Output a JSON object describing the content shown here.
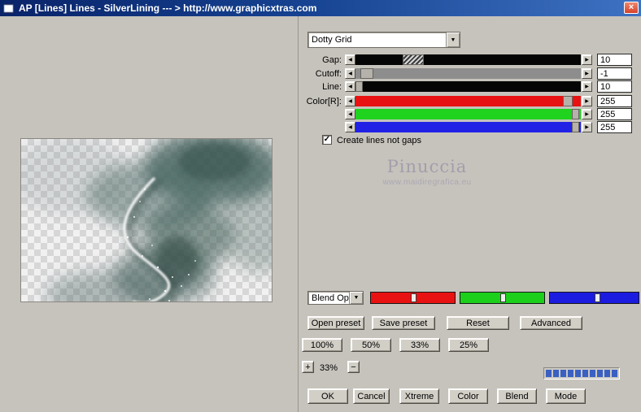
{
  "titlebar": {
    "title": "AP [Lines]  Lines - SilverLining    --- > http://www.graphicxtras.com",
    "close_glyph": "×"
  },
  "preset_dropdown": {
    "value": "Dotty Grid",
    "arrow_glyph": "▼"
  },
  "arrows": {
    "left": "◀",
    "right": "▶"
  },
  "sliders": [
    {
      "label": "Gap:",
      "value": "10",
      "track_color": "#050505",
      "thumb_pct": 21,
      "thumb_w": 26,
      "thumb_kind": "hatched"
    },
    {
      "label": "Cutoff:",
      "value": "-1",
      "track_color": "#8d8d8d",
      "thumb_pct": 2,
      "thumb_w": 16,
      "thumb_kind": "plain"
    },
    {
      "label": "Line:",
      "value": "10",
      "track_color": "#050505",
      "thumb_pct": 0,
      "thumb_w": 9,
      "thumb_kind": "plain"
    },
    {
      "label": "Color[R]:",
      "value": "255",
      "track_color": "#e81212",
      "thumb_pct": 92,
      "thumb_w": 12,
      "thumb_kind": "plain"
    },
    {
      "label": "",
      "value": "255",
      "track_color": "#1fd31f",
      "thumb_pct": 96,
      "thumb_w": 9,
      "thumb_kind": "plain"
    },
    {
      "label": "",
      "value": "255",
      "track_color": "#2121e6",
      "thumb_pct": 96,
      "thumb_w": 9,
      "thumb_kind": "plain"
    }
  ],
  "checkbox": {
    "label": "Create lines not gaps",
    "checked": true,
    "mark": "✓"
  },
  "watermark": {
    "line1": "Pinuccia",
    "line2": "www.maidiregrafica.eu"
  },
  "blend": {
    "dropdown_value": "Blend Optio",
    "arrow_glyph": "▼",
    "channels": [
      {
        "name": "red-channel",
        "color": "#e81212",
        "thumb_pct": 48
      },
      {
        "name": "green-channel",
        "color": "#1bcf1b",
        "thumb_pct": 48
      },
      {
        "name": "blue-channel",
        "color": "#1c1ce0",
        "thumb_pct": 50
      }
    ]
  },
  "preset_buttons": [
    "Open preset",
    "Save preset",
    "Reset",
    "Advanced"
  ],
  "zoom_presets": [
    "100%",
    "50%",
    "33%",
    "25%"
  ],
  "zoom": {
    "plus": "+",
    "level": "33%",
    "minus": "−"
  },
  "meter": {
    "segments": 10,
    "color": "#3a60c2"
  },
  "bottom_buttons": [
    "OK",
    "Cancel",
    "Xtreme",
    "Color",
    "Blend",
    "Mode"
  ]
}
